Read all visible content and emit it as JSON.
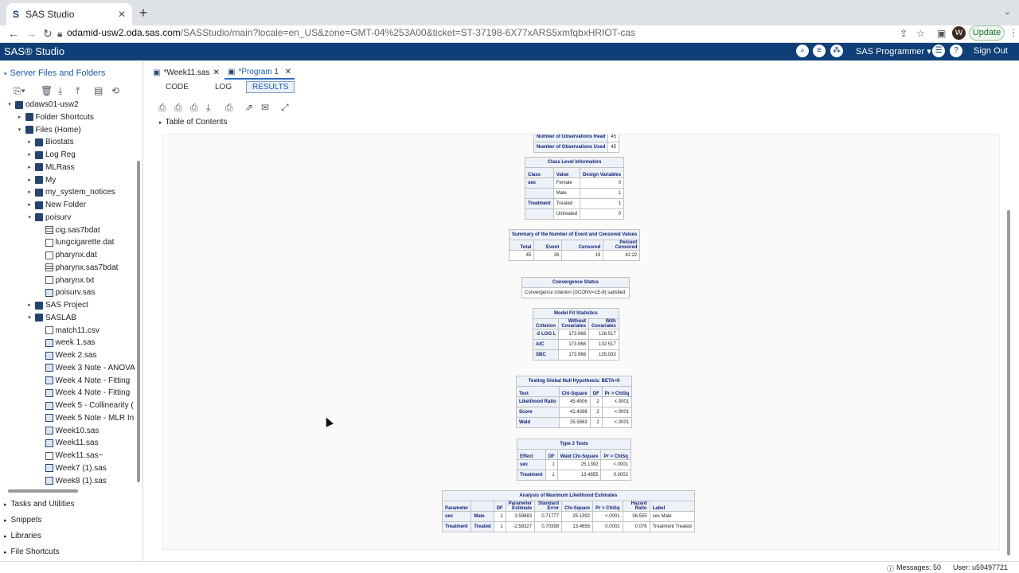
{
  "browser": {
    "tab_title": "SAS Studio",
    "url_host": "odamid-usw2.oda.sas.com",
    "url_rest": "/SASStudio/main?locale=en_US&zone=GMT-04%253A00&ticket=ST-37198-6X77xARS5xmfqbxHRIOT-cas",
    "avatar": "W",
    "update_label": "Update"
  },
  "app": {
    "logo": "SAS® Studio",
    "role": "SAS Programmer ▾",
    "sign_out": "Sign Out"
  },
  "nav": {
    "heading": "Server Files and Folders",
    "tree": [
      {
        "label": "odaws01-usw2",
        "depth": 1,
        "icon": "server",
        "arrow": "▾"
      },
      {
        "label": "Folder Shortcuts",
        "depth": 2,
        "icon": "folder-link",
        "arrow": "▸"
      },
      {
        "label": "Files (Home)",
        "depth": 2,
        "icon": "home-folder",
        "arrow": "▾"
      },
      {
        "label": "Biostats",
        "depth": 3,
        "icon": "folder",
        "arrow": "▸"
      },
      {
        "label": "Log Reg",
        "depth": 3,
        "icon": "folder",
        "arrow": "▸"
      },
      {
        "label": "MLRass",
        "depth": 3,
        "icon": "folder",
        "arrow": "▸"
      },
      {
        "label": "My",
        "depth": 3,
        "icon": "folder",
        "arrow": "▸"
      },
      {
        "label": "my_system_notices",
        "depth": 3,
        "icon": "folder",
        "arrow": "▸"
      },
      {
        "label": "New Folder",
        "depth": 3,
        "icon": "folder",
        "arrow": "▸"
      },
      {
        "label": "poisurv",
        "depth": 3,
        "icon": "folder",
        "arrow": "▾"
      },
      {
        "label": "cig.sas7bdat",
        "depth": 4,
        "icon": "dataset",
        "arrow": ""
      },
      {
        "label": "lungcigarette.dat",
        "depth": 4,
        "icon": "file",
        "arrow": ""
      },
      {
        "label": "pharynx.dat",
        "depth": 4,
        "icon": "file",
        "arrow": ""
      },
      {
        "label": "pharynx.sas7bdat",
        "depth": 4,
        "icon": "dataset",
        "arrow": ""
      },
      {
        "label": "pharynx.txt",
        "depth": 4,
        "icon": "file",
        "arrow": ""
      },
      {
        "label": "poisurv.sas",
        "depth": 4,
        "icon": "program",
        "arrow": ""
      },
      {
        "label": "SAS Project",
        "depth": 3,
        "icon": "folder",
        "arrow": "▸"
      },
      {
        "label": "SASLAB",
        "depth": 3,
        "icon": "folder",
        "arrow": "▾"
      },
      {
        "label": "match11.csv",
        "depth": 4,
        "icon": "file",
        "arrow": ""
      },
      {
        "label": "week 1.sas",
        "depth": 4,
        "icon": "program",
        "arrow": ""
      },
      {
        "label": "Week 2.sas",
        "depth": 4,
        "icon": "program",
        "arrow": ""
      },
      {
        "label": "Week 3 Note - ANOVA",
        "depth": 4,
        "icon": "program",
        "arrow": ""
      },
      {
        "label": "Week 4 Note - Fitting",
        "depth": 4,
        "icon": "program",
        "arrow": ""
      },
      {
        "label": "Week 4 Note - Fitting",
        "depth": 4,
        "icon": "program",
        "arrow": ""
      },
      {
        "label": "Week 5 - Collinearity (",
        "depth": 4,
        "icon": "program",
        "arrow": ""
      },
      {
        "label": "Week 5 Note - MLR In",
        "depth": 4,
        "icon": "program",
        "arrow": ""
      },
      {
        "label": "Week10.sas",
        "depth": 4,
        "icon": "program",
        "arrow": ""
      },
      {
        "label": "Week11.sas",
        "depth": 4,
        "icon": "program",
        "arrow": ""
      },
      {
        "label": "Week11.sas~",
        "depth": 4,
        "icon": "file",
        "arrow": ""
      },
      {
        "label": "Week7 (1).sas",
        "depth": 4,
        "icon": "program",
        "arrow": ""
      },
      {
        "label": "Week8 (1).sas",
        "depth": 4,
        "icon": "program",
        "arrow": ""
      }
    ],
    "sections": [
      "Tasks and Utilities",
      "Snippets",
      "Libraries",
      "File Shortcuts"
    ]
  },
  "program_tabs": [
    {
      "label": "*Week11.sas",
      "active": false
    },
    {
      "label": "*Program 1",
      "active": true
    }
  ],
  "sub_tabs": [
    "CODE",
    "LOG",
    "RESULTS"
  ],
  "toc_label": "Table of Contents",
  "results": {
    "obs": [
      [
        "Number of Observations Read",
        "45"
      ],
      [
        "Number of Observations Used",
        "45"
      ]
    ],
    "class_level": {
      "caption": "Class Level Information",
      "headers": [
        "Class",
        "Value",
        "Design Variables"
      ],
      "rows": [
        [
          "sex",
          "Female",
          "0"
        ],
        [
          "",
          "Male",
          "1"
        ],
        [
          "Treatment",
          "Treated",
          "1"
        ],
        [
          "",
          "Untreated",
          "0"
        ]
      ]
    },
    "event_summary": {
      "caption": "Summary of the Number of Event and Censored Values",
      "headers": [
        "Total",
        "Event",
        "Censored",
        "Percent Censored"
      ],
      "rows": [
        [
          "45",
          "26",
          "19",
          "42.22"
        ]
      ]
    },
    "convergence": {
      "caption": "Convergence Status",
      "text": "Convergence criterion (GCONV=1E-8) satisfied."
    },
    "fit": {
      "caption": "Model Fit Statistics",
      "headers": [
        "Criterion",
        "Without Covariates",
        "With Covariates"
      ],
      "rows": [
        [
          "-2 LOG L",
          "173.968",
          "128.517"
        ],
        [
          "AIC",
          "173.968",
          "132.517"
        ],
        [
          "SBC",
          "173.968",
          "135.033"
        ]
      ]
    },
    "global_null": {
      "caption": "Testing Global Null Hypothesis: BETA=0",
      "headers": [
        "Test",
        "Chi-Square",
        "DF",
        "Pr > ChiSq"
      ],
      "rows": [
        [
          "Likelihood Ratio",
          "45.4506",
          "2",
          "<.0001"
        ],
        [
          "Score",
          "41.4396",
          "2",
          "<.0001"
        ],
        [
          "Wald",
          "25.5883",
          "2",
          "<.0001"
        ]
      ]
    },
    "type3": {
      "caption": "Type 3 Tests",
      "headers": [
        "Effect",
        "DF",
        "Wald Chi-Square",
        "Pr > ChiSq"
      ],
      "rows": [
        [
          "sex",
          "1",
          "25.1392",
          "<.0001"
        ],
        [
          "Treatment",
          "1",
          "13.4655",
          "0.0002"
        ]
      ]
    },
    "mle": {
      "caption": "Analysis of Maximum Likelihood Estimates",
      "headers": [
        "Parameter",
        "",
        "DF",
        "Parameter Estimate",
        "Standard Error",
        "Chi-Square",
        "Pr > ChiSq",
        "Hazard Ratio",
        "Label"
      ],
      "rows": [
        [
          "sex",
          "Male",
          "1",
          "3.59883",
          "0.71777",
          "25.1392",
          "<.0001",
          "36.555",
          "sex Male"
        ],
        [
          "Treatment",
          "Treated",
          "1",
          "-2.58327",
          "0.70398",
          "13.4655",
          "0.0002",
          "0.076",
          "Treatment Treated"
        ]
      ]
    }
  },
  "status": {
    "messages": "Messages: 50",
    "user": "User: u59497721"
  }
}
